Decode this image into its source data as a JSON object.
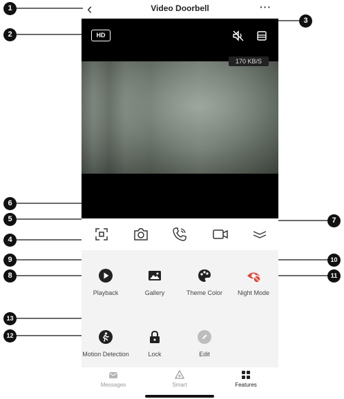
{
  "header": {
    "title": "Video Doorbell",
    "back_icon": "chevron-left-icon",
    "more_icon": "more-dots-icon"
  },
  "video": {
    "hd_label": "HD",
    "speed_label": "170 KB/S",
    "mute_icon": "speaker-muted-icon",
    "layout_icon": "layout-icon"
  },
  "toolbar": {
    "items": [
      {
        "name": "fullscreen-icon"
      },
      {
        "name": "camera-icon"
      },
      {
        "name": "talk-icon"
      },
      {
        "name": "record-icon"
      },
      {
        "name": "collapse-icon"
      }
    ]
  },
  "features": {
    "playback": "Playback",
    "gallery": "Gallery",
    "theme_color": "Theme Color",
    "night_mode": "Night Mode",
    "motion_detection": "Motion Detection",
    "lock": "Lock",
    "edit": "Edit"
  },
  "tabs": {
    "messages": "Messages",
    "smart": "Smart",
    "features": "Features"
  },
  "callouts": [
    "1",
    "2",
    "3",
    "4",
    "5",
    "6",
    "7",
    "8",
    "9",
    "10",
    "11",
    "12",
    "13"
  ],
  "colors": {
    "accent_red": "#e24b3b",
    "icon_dark": "#222222",
    "edit_grey": "#bdbdbd",
    "panel_bg": "#f3f3f3"
  }
}
